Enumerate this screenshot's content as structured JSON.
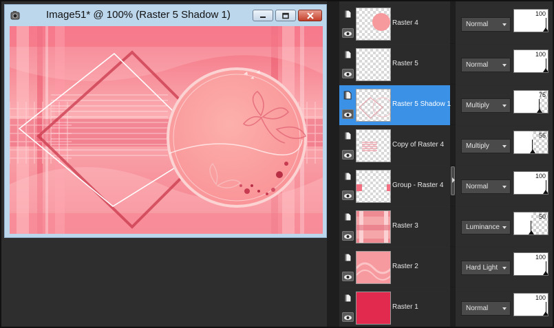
{
  "document": {
    "title": "Image51* @ 100% (Raster 5 Shadow 1)",
    "window_buttons": [
      "minimize",
      "maximize",
      "close"
    ]
  },
  "canvas_colors": {
    "pink": "#f5878f",
    "light_pink": "#fbb3b6",
    "deep_pink": "#e8465c",
    "circle": "#fba3a3",
    "frame_dark": "#c9394c",
    "frame_light": "#ffffff"
  },
  "layers": [
    {
      "name": "Raster 4",
      "blend": "Normal",
      "opacity": 100,
      "thumb": "pink-circle",
      "selected": false
    },
    {
      "name": "Raster 5",
      "blend": "Normal",
      "opacity": 100,
      "thumb": "transparent",
      "selected": false
    },
    {
      "name": "Raster 5 Shadow 1",
      "blend": "Multiply",
      "opacity": 75,
      "thumb": "shadow-outline",
      "selected": true
    },
    {
      "name": "Copy of Raster 4",
      "blend": "Multiply",
      "opacity": 55,
      "thumb": "lines",
      "selected": false
    },
    {
      "name": "Group - Raster 4",
      "blend": "Normal",
      "opacity": 100,
      "thumb": "group",
      "selected": false
    },
    {
      "name": "Raster 3",
      "blend": "Luminance",
      "opacity": 50,
      "thumb": "pattern",
      "selected": false
    },
    {
      "name": "Raster 2",
      "blend": "Hard Light",
      "opacity": 100,
      "thumb": "pink-texture",
      "selected": false
    },
    {
      "name": "Raster 1",
      "blend": "Normal",
      "opacity": 100,
      "thumb": "solid-red",
      "selected": false
    }
  ],
  "colors": {
    "selection": "#3b91e6",
    "raster1": "#e12a4d"
  }
}
